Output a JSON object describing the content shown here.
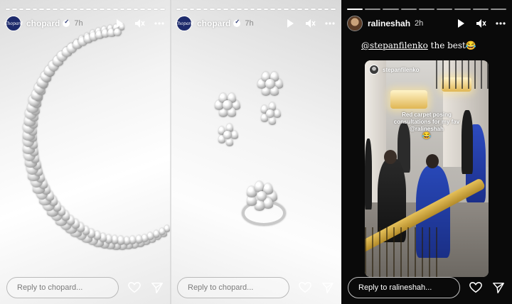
{
  "stories": [
    {
      "username": "chopard",
      "avatar_text": "Chopard",
      "verified": true,
      "time": "7h",
      "progress_segments": 24,
      "progress_done": 24,
      "reply_placeholder": "Reply to chopard...",
      "icons": [
        "play-icon",
        "mute-icon",
        "more-icon",
        "heart-icon",
        "send-icon"
      ]
    },
    {
      "username": "chopard",
      "avatar_text": "Chopard",
      "verified": true,
      "time": "7h",
      "progress_segments": 24,
      "progress_done": 24,
      "reply_placeholder": "Reply to chopard...",
      "icons": [
        "play-icon",
        "mute-icon",
        "more-icon",
        "heart-icon",
        "send-icon"
      ]
    },
    {
      "username": "ralineshah",
      "verified": false,
      "time": "2h",
      "progress_segments": 9,
      "progress_done": 1,
      "reply_placeholder": "Reply to ralineshah...",
      "caption_mention": "@stepanfilenko",
      "caption_text": " the best😂",
      "card_username": "stepanfilenko",
      "card_text": "Red carpet posing consultations for my fav @ralineshah",
      "card_emoji": "😂",
      "icons": [
        "play-icon",
        "mute-icon",
        "more-icon",
        "heart-icon",
        "send-icon"
      ]
    }
  ],
  "colors": {
    "chopard_avatar": "#1d2a6b",
    "gold_rail": "#d4ac44",
    "blue_dress": "#1f3fa8"
  }
}
